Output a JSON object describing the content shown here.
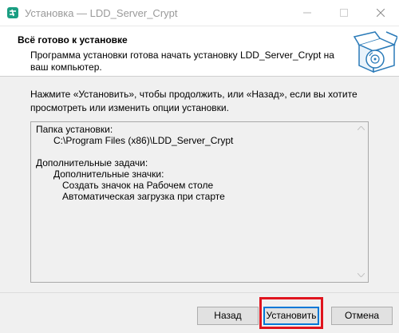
{
  "window": {
    "title": "Установка — LDD_Server_Crypt",
    "icons": [
      "app-icon",
      "minimize-icon",
      "maximize-icon",
      "close-icon"
    ]
  },
  "header": {
    "title": "Всё готово к установке",
    "description": "Программа установки готова начать установку LDD_Server_Crypt на ваш компьютер.",
    "image": "installer-box-disc-icon"
  },
  "instructions": "Нажмите «Установить», чтобы продолжить, или «Назад», если вы хотите просмотреть или изменить опции установки.",
  "memo": {
    "dest_label": "Папка установки:",
    "dest_path": "C:\\Program Files (x86)\\LDD_Server_Crypt",
    "tasks_label": "Дополнительные задачи:",
    "tasks_group": "Дополнительные значки:",
    "tasks": [
      "Создать значок на Рабочем столе",
      "Автоматическая загрузка при старте"
    ]
  },
  "buttons": {
    "back": "Назад",
    "install": "Установить",
    "cancel": "Отмена"
  },
  "colors": {
    "highlight": "#e0141e",
    "accent": "#0078d7",
    "app_icon": "#1a9e82"
  }
}
